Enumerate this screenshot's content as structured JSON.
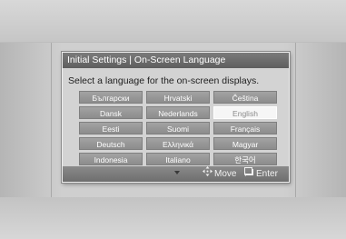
{
  "dialog": {
    "title": "Initial Settings | On-Screen Language",
    "prompt": "Select a language for the on-screen displays."
  },
  "languages": [
    {
      "label": "Български",
      "selected": false
    },
    {
      "label": "Hrvatski",
      "selected": false
    },
    {
      "label": "Čeština",
      "selected": false
    },
    {
      "label": "Dansk",
      "selected": false
    },
    {
      "label": "Nederlands",
      "selected": false
    },
    {
      "label": "English",
      "selected": true
    },
    {
      "label": "Eesti",
      "selected": false
    },
    {
      "label": "Suomi",
      "selected": false
    },
    {
      "label": "Français",
      "selected": false
    },
    {
      "label": "Deutsch",
      "selected": false
    },
    {
      "label": "Ελληνικά",
      "selected": false
    },
    {
      "label": "Magyar",
      "selected": false
    },
    {
      "label": "Indonesia",
      "selected": false
    },
    {
      "label": "Italiano",
      "selected": false
    },
    {
      "label": "한국어",
      "selected": false
    }
  ],
  "footer": {
    "move_label": "Move",
    "enter_label": "Enter",
    "move_icon": "move-arrows-icon",
    "enter_icon": "enter-icon"
  },
  "colors": {
    "title_bar": "#6e6e6e",
    "button": "#969696",
    "selected_button": "#f6f6f6"
  }
}
